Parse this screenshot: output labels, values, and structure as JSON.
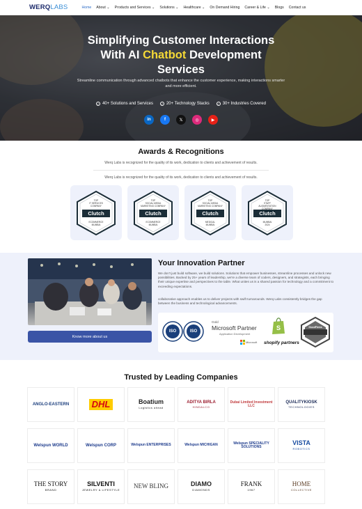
{
  "nav": {
    "logo_main": "WERQ",
    "logo_sub": "LABS",
    "items": [
      "Home",
      "About ⌄",
      "Products and Services ⌄",
      "Solutions ⌄",
      "Healthcare ⌄",
      "On Demand Hiring",
      "Career & Life ⌄",
      "Blogs",
      "Contact us"
    ]
  },
  "hero": {
    "title_line1": "Simplifying Customer Interactions",
    "title_pre": "With AI ",
    "title_highlight": "Chatbot",
    "title_post": " Development",
    "title_line3": "Services",
    "subtitle": "Streamline communication through advanced chatbots that enhance the customer experience, making interactions smarter and more efficient.",
    "stats": [
      "40+ Solutions and Services",
      "20+ Technology Stacks",
      "30+ Industries Covered"
    ],
    "socials": [
      {
        "icon": "linkedin-icon",
        "glyph": "in",
        "color": "#0a66c2"
      },
      {
        "icon": "facebook-icon",
        "glyph": "f",
        "color": "#1877f2"
      },
      {
        "icon": "x-icon",
        "glyph": "𝕏",
        "color": "#111111"
      },
      {
        "icon": "instagram-icon",
        "glyph": "◎",
        "color": "#dd2a7b"
      },
      {
        "icon": "youtube-icon",
        "glyph": "▶",
        "color": "#e62117"
      }
    ]
  },
  "awards": {
    "title": "Awards & Recognitions",
    "line1": "Werq Labs is recognized for the quality of its work, dedication to clients and achievement of results.",
    "line2": "Werq Labs is recognized for the quality of its work, dedication to clients and achievement of results.",
    "badges": [
      {
        "top": "TOP\nIT SERVICES\nCOMPANY",
        "brand": "Clutch",
        "bottom": "ECOMMERCE\nMUMBAI"
      },
      {
        "top": "TOP\nSOCIAL MEDIA\nMARKETING COMPANY",
        "brand": "Clutch",
        "bottom": "ECOMMERCE\nMUMBAI"
      },
      {
        "top": "TOP\nSOCIAL MEDIA\nMARKETING COMPANY",
        "brand": "Clutch",
        "bottom": "MEDICAL\nMUMBAI"
      },
      {
        "top": "TOP\nSTAFF\nAUGMENTATION\nCOMPANY",
        "brand": "Clutch",
        "bottom": "MUMBAI\n2024"
      }
    ]
  },
  "partner": {
    "title": "Your Innovation Partner",
    "para1": "We don't just build software, we build solutions. Solutions that empower businesses, streamline processes and unlock new possibilities. Backed by 25+ years of leadership, we're a diverse team of coders, designers, and strategists, each bringing their unique expertise and perspectives to the table. What unites us is a shared passion for technology and a commitment to exceeding expectations.",
    "para2": "collaborative approach enables us to deliver projects with swift turnarounds. Werq Labs consistently bridges the gap between the business and technological advancements.",
    "button": "Know more about us",
    "certs": {
      "iso": "ISO",
      "ms_gold": "Gold",
      "ms_name": "Microsoft Partner",
      "ms_sub": "Application Development",
      "ms_foot": "Microsoft",
      "shopify": "shopify partners",
      "goodfirms": "GoodFirms"
    }
  },
  "trusted": {
    "title": "Trusted by Leading Companies",
    "logos": [
      {
        "name": "ANGLO-EASTERN",
        "color": "#1a3d7c"
      },
      {
        "name": "DHL",
        "color": "#d40511"
      },
      {
        "name": "Boatium",
        "sub": "Logistics ahead",
        "color": "#222222"
      },
      {
        "name": "ADITYA BIRLA",
        "sub": "HINDALCO",
        "color": "#9b1c2e"
      },
      {
        "name": "Dubai Limited Investment LLC",
        "color": "#c0393b"
      },
      {
        "name": "QUALITYKIOSK",
        "sub": "TECHNOLOGIES",
        "color": "#1c2b58"
      },
      {
        "name": "Welspun WORLD",
        "color": "#1d3b8c"
      },
      {
        "name": "Welspun CORP",
        "color": "#1d3b8c"
      },
      {
        "name": "Welspun ENTERPRISES",
        "color": "#1d3b8c"
      },
      {
        "name": "Welspun MICHIGAN",
        "color": "#1d3b8c"
      },
      {
        "name": "Welspun SPECIALITY SOLUTIONS",
        "color": "#1d3b8c"
      },
      {
        "name": "VISTA",
        "sub": "ROBOTICS",
        "color": "#1a4da1"
      },
      {
        "name": "THE STORY",
        "sub": "BRAND",
        "color": "#111111"
      },
      {
        "name": "SILVENTI",
        "sub": "JEWELRY & LIFESTYLE",
        "color": "#111111"
      },
      {
        "name": "NEW BLING",
        "color": "#333333"
      },
      {
        "name": "DIAMO",
        "sub": "DIAMONDS",
        "color": "#222222"
      },
      {
        "name": "FRANK",
        "sub": "1967",
        "color": "#111111"
      },
      {
        "name": "HOME",
        "sub": "COLLECTIVE",
        "color": "#5a3a22"
      }
    ]
  }
}
